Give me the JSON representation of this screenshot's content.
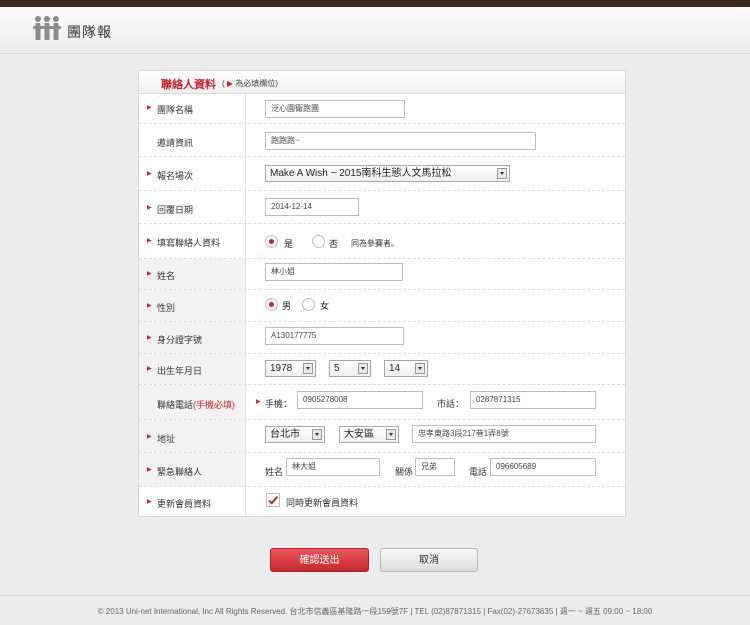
{
  "header": {
    "title": "團隊報"
  },
  "form": {
    "section_title": "聯絡人資料",
    "required_note": "為必填欄位",
    "fields": {
      "team_name": {
        "label": "團隊名稱",
        "value": "泛心園衛跑團"
      },
      "invite_info": {
        "label": "邀請資訊",
        "value": "跑跑跑~"
      },
      "event": {
        "label": "報名場次",
        "value": "Make A Wish ~ 2015南科生態人文馬拉松"
      },
      "reply_date": {
        "label": "回覆日期",
        "value": "2014-12-14"
      },
      "fill_contact": {
        "label": "填寫聯絡人資料",
        "yes": "是",
        "no": "否",
        "note": "同為參賽者。"
      },
      "name": {
        "label": "姓名",
        "value": "林小姐"
      },
      "gender": {
        "label": "性別",
        "male": "男",
        "female": "女"
      },
      "id_number": {
        "label": "身分證字號",
        "value": "A130177775"
      },
      "birthday": {
        "label": "出生年月日",
        "year": "1978",
        "month": "5",
        "day": "14"
      },
      "phone": {
        "label": "聯絡電話",
        "label_note": "(手機必填)",
        "mobile_label": "手機：",
        "mobile": "0905278008",
        "tel_label": "市話：",
        "tel": "0287871315"
      },
      "address": {
        "label": "地址",
        "city": "台北市",
        "district": "大安區",
        "street": "忠孝東路3段217巷1弄8號"
      },
      "emergency": {
        "label": "緊急聯絡人",
        "name_label": "姓名",
        "name": "林大姐",
        "relation_label": "關係",
        "relation": "兄弟",
        "phone_label": "電話",
        "phone": "096605689"
      },
      "update_member": {
        "label": "更新會員資料",
        "check_label": "同時更新會員資料"
      }
    }
  },
  "buttons": {
    "submit": "確認送出",
    "cancel": "取消"
  },
  "footer": {
    "text": "© 2013 Uni-net International, Inc All Rights Reserved. 台北市信義區基隆路一段159號7F | TEL (02)87871315 | Fax(02)-27673635 | 週一 ~ 週五 09:00 ~ 18:00"
  },
  "colors": {
    "accent": "#c8262b",
    "topbar": "#3b2a1c"
  }
}
